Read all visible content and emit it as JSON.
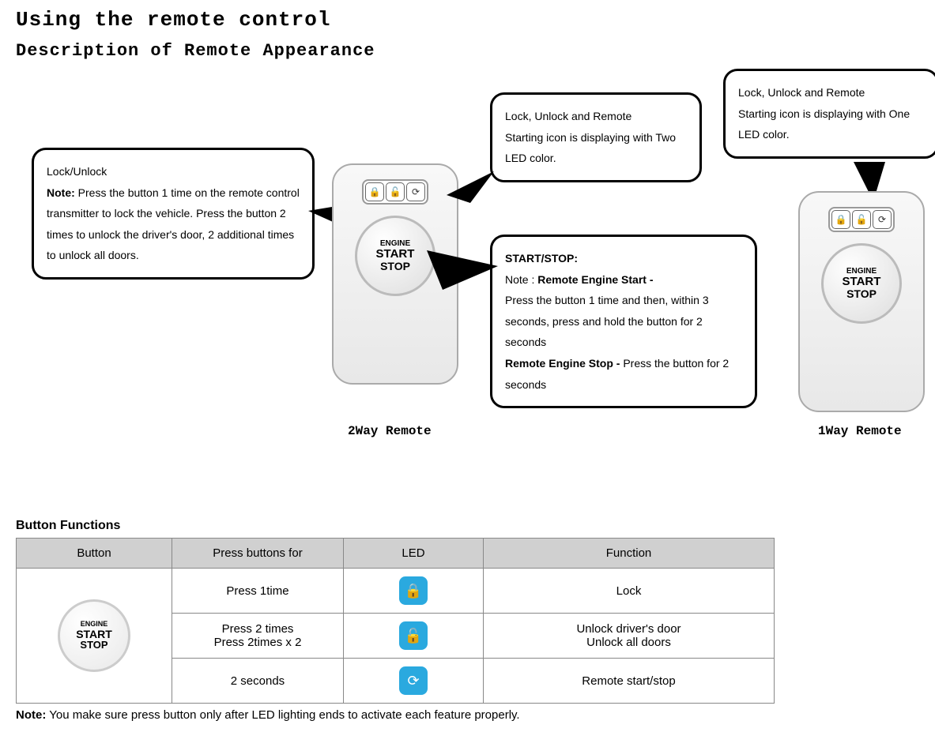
{
  "titles": {
    "main": "Using the remote control",
    "sub": "Description of Remote Appearance"
  },
  "callouts": {
    "lockUnlock": {
      "heading": "Lock/Unlock",
      "noteLabel": "Note:",
      "body": "Press the button 1 time on the remote control transmitter to lock the vehicle. Press the button 2 times to unlock the driver's door, 2 additional times to unlock all doors."
    },
    "twoLed": {
      "line1": "Lock, Unlock and Remote",
      "line2": "Starting icon is displaying with Two LED color."
    },
    "startStop": {
      "heading": "START/STOP:",
      "noteLabel": "Note :",
      "startBold": "Remote Engine Start -",
      "startBody": "Press the button 1 time and then, within 3 seconds, press and hold the button for 2 seconds",
      "stopBold": "Remote Engine Stop -",
      "stopBody": "Press the button for 2 seconds"
    },
    "oneLed": {
      "line1": "Lock, Unlock and Remote",
      "line2": "Starting icon is displaying with One LED color."
    }
  },
  "remotes": {
    "engineLine1": "ENGINE",
    "engineLine2": "START",
    "engineLine3": "STOP",
    "label2way": "2Way Remote",
    "label1way": "1Way Remote"
  },
  "table": {
    "sectionTitle": "Button Functions",
    "headers": {
      "button": "Button",
      "press": "Press buttons for",
      "led": "LED",
      "func": "Function"
    },
    "rows": {
      "r1": {
        "press": "Press 1time",
        "func": "Lock"
      },
      "r2": {
        "press1": "Press 2 times",
        "press2": "Press 2times x 2",
        "func1": "Unlock driver's door",
        "func2": "Unlock all doors"
      },
      "r3": {
        "press": "2 seconds",
        "func": "Remote start/stop"
      }
    },
    "footNoteLabel": "Note:",
    "footNote": "You make sure press button only after LED lighting ends to activate each feature properly."
  }
}
